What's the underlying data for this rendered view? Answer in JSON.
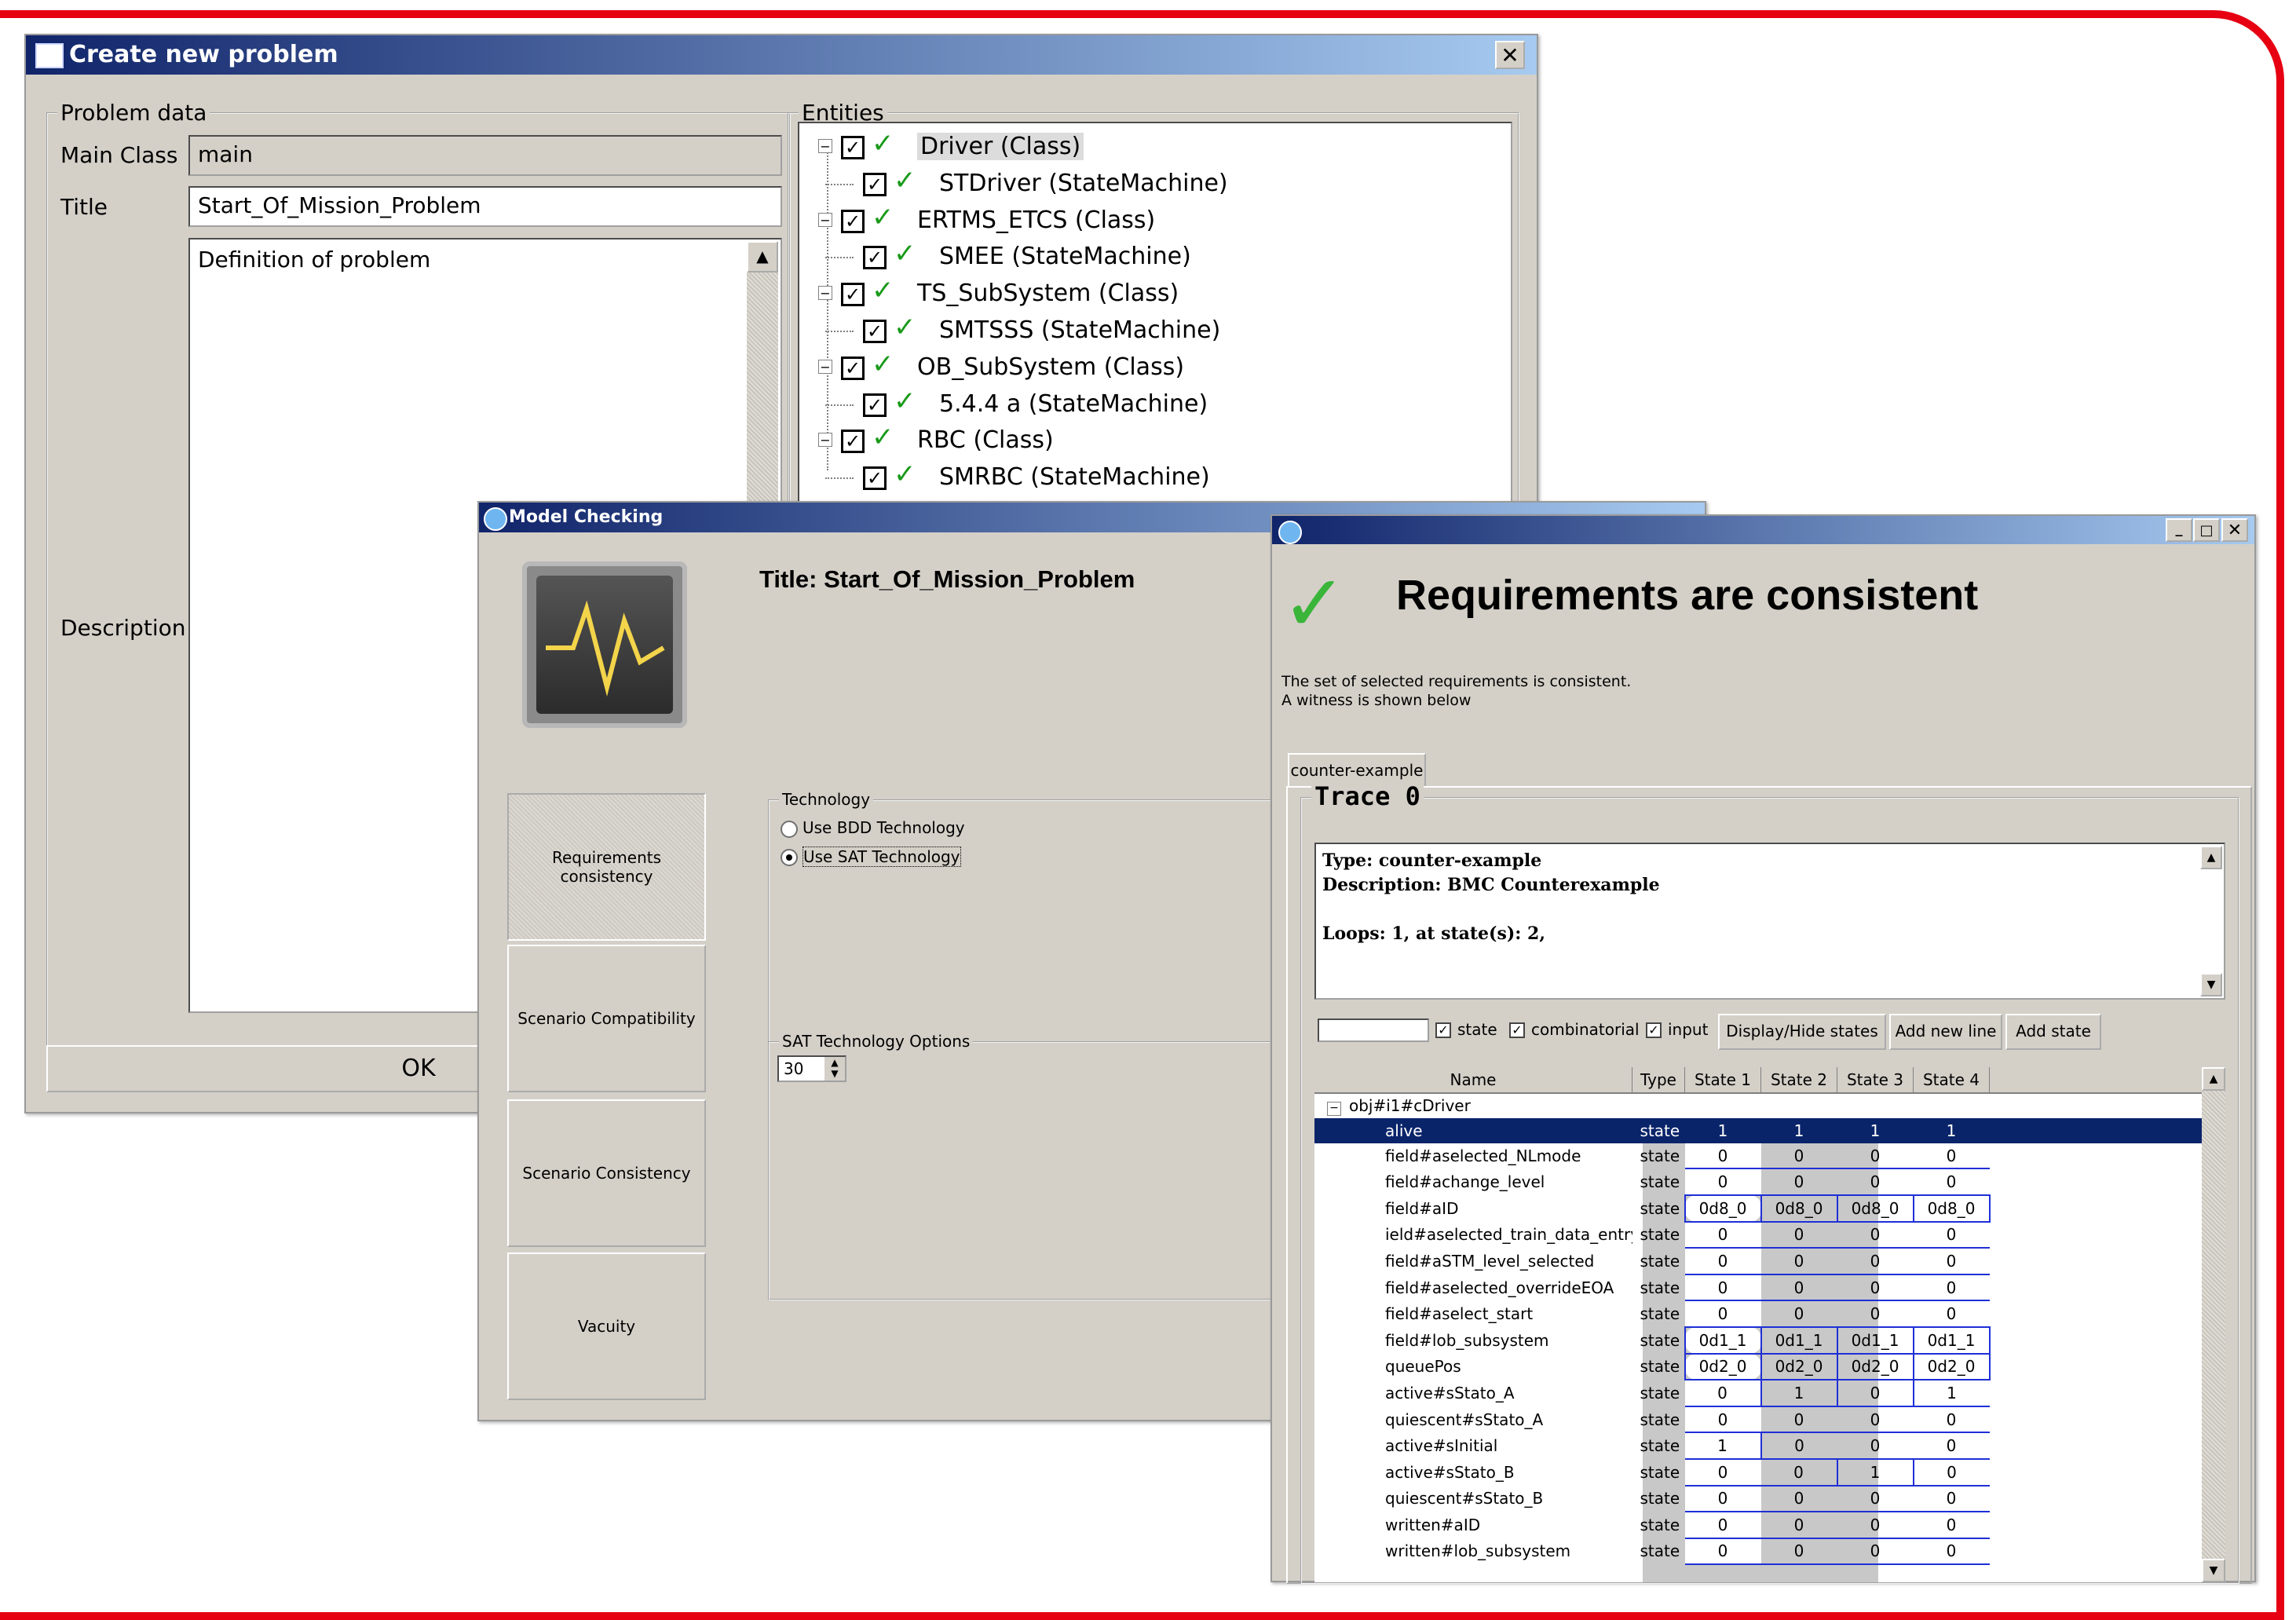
{
  "create_problem": {
    "title": "Create new problem",
    "problem_data_label": "Problem data",
    "main_class_label": "Main Class",
    "main_class_value": "main",
    "title_label": "Title",
    "title_value": "Start_Of_Mission_Problem",
    "description_label": "Description",
    "description_value": "Definition of problem",
    "ok_label": "OK",
    "entities_label": "Entities",
    "entities": [
      {
        "label": "Driver (Class)",
        "child": "STDriver (StateMachine)"
      },
      {
        "label": "ERTMS_ETCS (Class)",
        "child": "SMEE (StateMachine)"
      },
      {
        "label": "TS_SubSystem (Class)",
        "child": "SMTSSS (StateMachine)"
      },
      {
        "label": "OB_SubSystem (Class)",
        "child": "5.4.4 a (StateMachine)"
      },
      {
        "label": "RBC (Class)",
        "child": "SMRBC (StateMachine)"
      }
    ]
  },
  "model_checking": {
    "title": "Model Checking",
    "problem_title": "Title: Start_Of_Mission_Problem",
    "tabs": [
      "Requirements consistency",
      "Scenario Compatibility",
      "Scenario Consistency",
      "Vacuity"
    ],
    "technology_label": "Technology",
    "options": [
      "Use BDD Technology",
      "Use SAT Technology"
    ],
    "selected_option": "Use SAT Technology",
    "sat_options_label": "SAT Technology Options",
    "sat_value": "30"
  },
  "result": {
    "heading": "Requirements are consistent",
    "message_line1": "The set of selected requirements is consistent.",
    "message_line2": "A witness is shown below",
    "tab_label": "counter-example",
    "trace_title": "Trace 0",
    "trace_lines": [
      "Type: counter-example",
      "Description: BMC Counterexample",
      "",
      "Loops: 1, at state(s): 2,"
    ],
    "filters": [
      "state",
      "combinatorial",
      "input"
    ],
    "buttons": [
      "Display/Hide states",
      "Add new line",
      "Add state"
    ],
    "columns": [
      "Name",
      "Type",
      "State 1",
      "State 2",
      "State 3",
      "State 4"
    ],
    "root_node": "obj#i1#cDriver",
    "rows": [
      {
        "name": "alive",
        "type": "state",
        "values": [
          "1",
          "1",
          "1",
          "1"
        ]
      },
      {
        "name": "field#aselected_NLmode",
        "type": "state",
        "values": [
          "0",
          "0",
          "0",
          "0"
        ]
      },
      {
        "name": "field#achange_level",
        "type": "state",
        "values": [
          "0",
          "0",
          "0",
          "0"
        ]
      },
      {
        "name": "field#aID",
        "type": "state",
        "values": [
          "0d8_0",
          "0d8_0",
          "0d8_0",
          "0d8_0"
        ]
      },
      {
        "name": "ield#aselected_train_data_entry",
        "type": "state",
        "values": [
          "0",
          "0",
          "0",
          "0"
        ]
      },
      {
        "name": "field#aSTM_level_selected",
        "type": "state",
        "values": [
          "0",
          "0",
          "0",
          "0"
        ]
      },
      {
        "name": "field#aselected_overrideEOA",
        "type": "state",
        "values": [
          "0",
          "0",
          "0",
          "0"
        ]
      },
      {
        "name": "field#aselect_start",
        "type": "state",
        "values": [
          "0",
          "0",
          "0",
          "0"
        ]
      },
      {
        "name": "field#lob_subsystem",
        "type": "state",
        "values": [
          "0d1_1",
          "0d1_1",
          "0d1_1",
          "0d1_1"
        ]
      },
      {
        "name": "queuePos",
        "type": "state",
        "values": [
          "0d2_0",
          "0d2_0",
          "0d2_0",
          "0d2_0"
        ]
      },
      {
        "name": "active#sStato_A",
        "type": "state",
        "values": [
          "0",
          "1",
          "0",
          "1"
        ]
      },
      {
        "name": "quiescent#sStato_A",
        "type": "state",
        "values": [
          "0",
          "0",
          "0",
          "0"
        ]
      },
      {
        "name": "active#sInitial",
        "type": "state",
        "values": [
          "1",
          "0",
          "0",
          "0"
        ]
      },
      {
        "name": "active#sStato_B",
        "type": "state",
        "values": [
          "0",
          "0",
          "1",
          "0"
        ]
      },
      {
        "name": "quiescent#sStato_B",
        "type": "state",
        "values": [
          "0",
          "0",
          "0",
          "0"
        ]
      },
      {
        "name": "written#aID",
        "type": "state",
        "values": [
          "0",
          "0",
          "0",
          "0"
        ]
      },
      {
        "name": "written#lob_subsystem",
        "type": "state",
        "values": [
          "0",
          "0",
          "0",
          "0"
        ]
      }
    ]
  },
  "colors": {
    "slide_frame": "#e60012",
    "title_bar": "#10246a",
    "selection": "#0a246a",
    "checkmark": "#1a9a1a",
    "signal": "#1f2fd6"
  }
}
